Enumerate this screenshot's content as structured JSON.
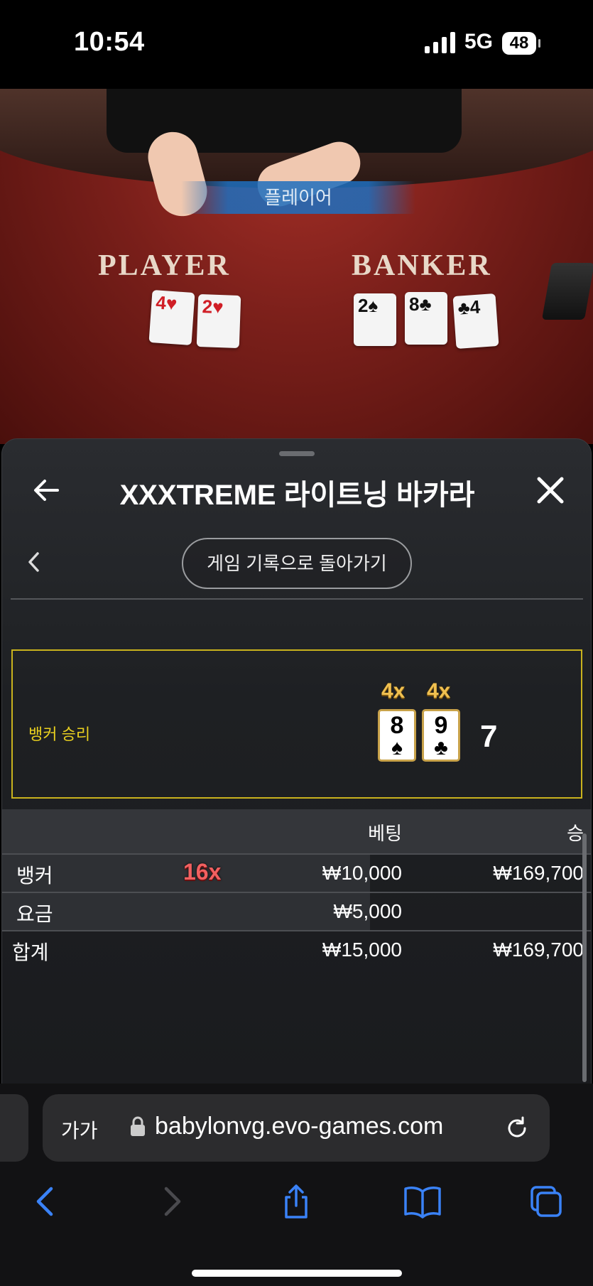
{
  "status_bar": {
    "time": "10:54",
    "network": "5G",
    "battery": "48"
  },
  "video": {
    "tag": "플레이어",
    "player_label": "PLAYER",
    "banker_label": "BANKER",
    "player_cards": [
      {
        "rank": "4",
        "suit": "♥"
      },
      {
        "rank": "2",
        "suit": "♥"
      }
    ],
    "banker_cards": [
      {
        "rank": "2",
        "suit": "♠"
      },
      {
        "rank": "8",
        "suit": "♣"
      },
      {
        "rank": "4",
        "suit": "♣"
      }
    ]
  },
  "panel": {
    "title": "XXXTREME 라이트닝 바카라",
    "history_button": "게임 기록으로 돌아가기",
    "result": {
      "label": "뱅커 승리",
      "cards": [
        {
          "rank": "8",
          "suit": "♠",
          "multiplier": "4x"
        },
        {
          "rank": "9",
          "suit": "♣",
          "multiplier": "4x"
        }
      ],
      "score": "7"
    },
    "bets_table": {
      "headers": {
        "bet": "베팅",
        "win": "승"
      },
      "rows": [
        {
          "name": "뱅커",
          "multiplier": "16x",
          "bet": "₩10,000",
          "win": "₩169,700"
        },
        {
          "name": "요금",
          "bet": "₩5,000",
          "win": ""
        }
      ],
      "total": {
        "name": "합계",
        "bet": "₩15,000",
        "win": "₩169,700"
      }
    }
  },
  "browser": {
    "text_size_label": "가가",
    "url": "babylonvg.evo-games.com",
    "accent_color": "#3a82f7"
  }
}
